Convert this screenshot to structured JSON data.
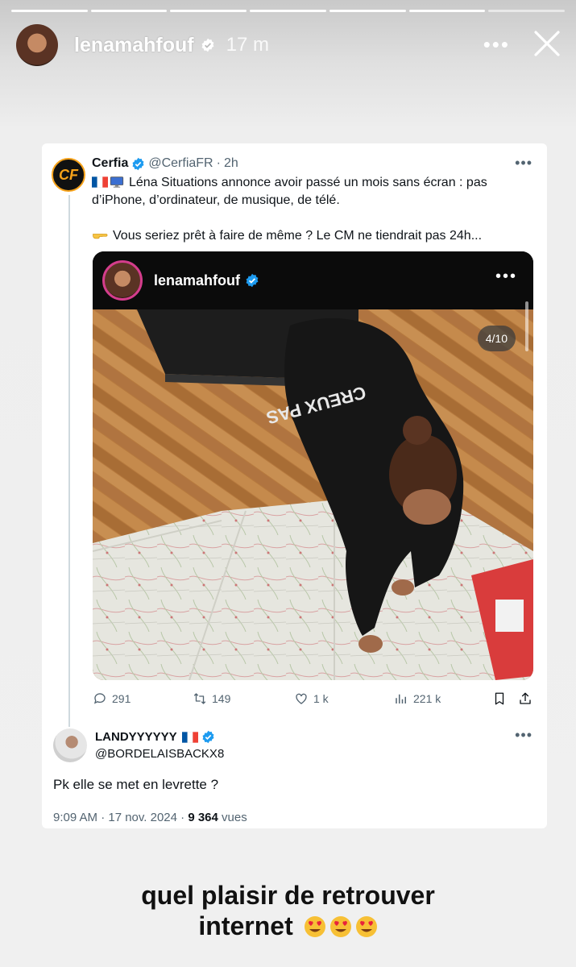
{
  "story": {
    "progress_segments": 7,
    "username": "lenamahfouf",
    "time": "17 m",
    "more_label": "•••",
    "caption_line1": "quel plaisir de retrouver",
    "caption_line2": "internet"
  },
  "tweet": {
    "name": "Cerfia",
    "handle": "@CerfiaFR",
    "sep": "·",
    "time": "2h",
    "line1": "Léna Situations annonce avoir passé un mois sans écran : pas d’iPhone, d’ordinateur, de musique, de télé.",
    "line2": "Vous seriez prêt à faire de même ? Le CM ne tiendrait pas 24h...",
    "more": "•••",
    "logo_text": "CF"
  },
  "media": {
    "username": "lenamahfouf",
    "counter": "4/10",
    "more": "•••"
  },
  "actions": {
    "replies": "291",
    "retweets": "149",
    "likes": "1 k",
    "views": "221 k"
  },
  "reply": {
    "name": "LANDYYYYYY",
    "handle": "@BORDELAISBACKX8",
    "text": "Pk elle se met en levrette ?",
    "datetime": "9:09 AM · 17 nov. 2024 ·",
    "views_count": "9 364",
    "views_label": "vues",
    "more": "•••"
  },
  "colors": {
    "verified_blue": "#1d9bf0",
    "accent_orange": "#f6a21a"
  },
  "icons": [
    "close-icon",
    "verified-icon",
    "reply-icon",
    "retweet-icon",
    "like-icon",
    "views-icon",
    "bookmark-icon",
    "share-icon",
    "flag-france-icon",
    "monitor-icon",
    "pointing-hand-icon",
    "heart-eyes-emoji"
  ]
}
